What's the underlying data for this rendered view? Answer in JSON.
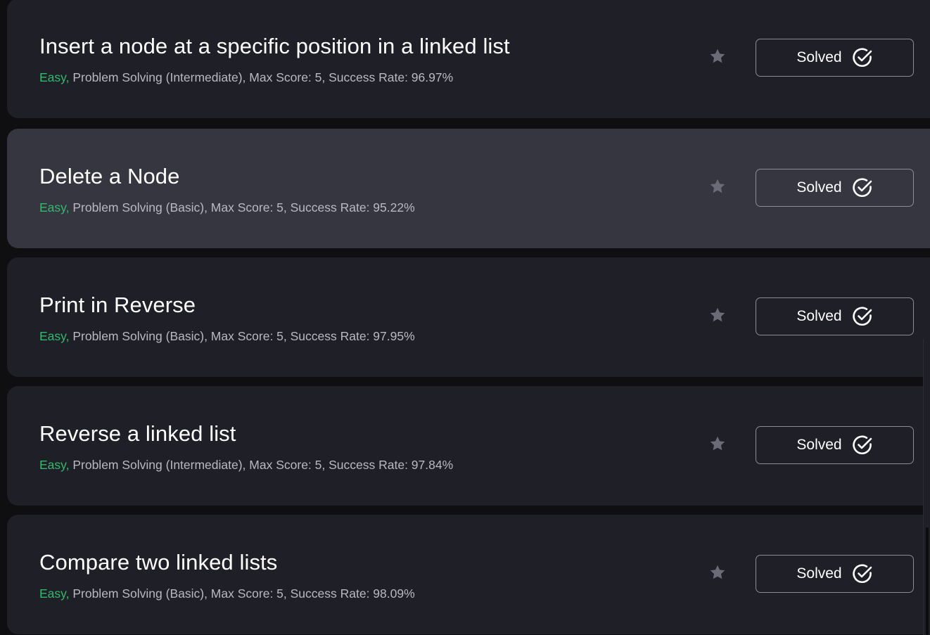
{
  "challenges": [
    {
      "title": "Insert a node at a specific position in a linked list",
      "difficulty": "Easy,",
      "details": "Problem Solving (Intermediate), Max Score: 5, Success Rate: 96.97%",
      "status_label": "Solved"
    },
    {
      "title": "Delete a Node",
      "difficulty": "Easy,",
      "details": "Problem Solving (Basic), Max Score: 5, Success Rate: 95.22%",
      "status_label": "Solved"
    },
    {
      "title": "Print in Reverse",
      "difficulty": "Easy,",
      "details": "Problem Solving (Basic), Max Score: 5, Success Rate: 97.95%",
      "status_label": "Solved"
    },
    {
      "title": "Reverse a linked list",
      "difficulty": "Easy,",
      "details": "Problem Solving (Intermediate), Max Score: 5, Success Rate: 97.84%",
      "status_label": "Solved"
    },
    {
      "title": "Compare two linked lists",
      "difficulty": "Easy,",
      "details": "Problem Solving (Basic), Max Score: 5, Success Rate: 98.09%",
      "status_label": "Solved"
    }
  ],
  "icons": {
    "bookmark": "star-icon",
    "status": "check-circle-icon"
  },
  "colors": {
    "card_background": "#1f1f27",
    "card_hover_background": "#363640",
    "easy": "#2ebc6b",
    "meta_text": "#b9b9c3",
    "star": "#6b6b78",
    "button_border": "#8c8c96"
  }
}
